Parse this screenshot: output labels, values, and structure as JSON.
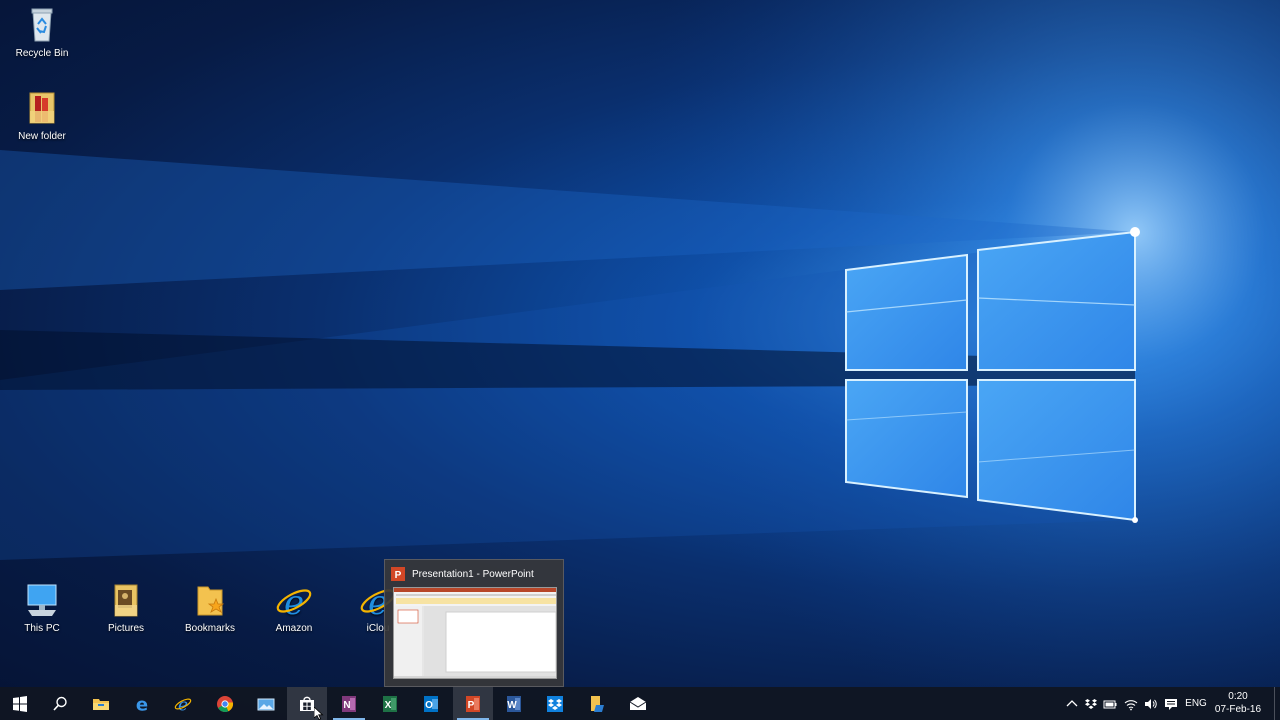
{
  "desktop": {
    "icons_top": [
      {
        "label": "Recycle Bin",
        "icon": "recycle-bin-icon"
      },
      {
        "label": "New folder",
        "icon": "folder-books-icon"
      }
    ],
    "icons_bottom": [
      {
        "label": "This PC",
        "icon": "computer-icon"
      },
      {
        "label": "Pictures",
        "icon": "pictures-folder-icon"
      },
      {
        "label": "Bookmarks",
        "icon": "bookmarks-folder-icon"
      },
      {
        "label": "Amazon",
        "icon": "internet-explorer-icon"
      },
      {
        "label": "iClou",
        "icon": "internet-explorer-icon"
      }
    ]
  },
  "thumbnail": {
    "title": "Presentation1 - PowerPoint",
    "icon": "powerpoint-icon"
  },
  "taskbar": {
    "start": "windows-logo-icon",
    "search": "search-icon",
    "apps": [
      {
        "name": "file-explorer",
        "icon": "folder-icon",
        "running": false
      },
      {
        "name": "edge",
        "icon": "edge-icon",
        "running": false
      },
      {
        "name": "internet-explorer",
        "icon": "internet-explorer-icon",
        "running": false
      },
      {
        "name": "chrome",
        "icon": "chrome-icon",
        "running": false
      },
      {
        "name": "photos",
        "icon": "photos-icon",
        "running": false
      },
      {
        "name": "store",
        "icon": "store-icon",
        "running": false,
        "hovered": true
      },
      {
        "name": "onenote",
        "icon": "onenote-icon",
        "running": true
      },
      {
        "name": "excel",
        "icon": "excel-icon",
        "running": false
      },
      {
        "name": "outlook",
        "icon": "outlook-icon",
        "running": false
      },
      {
        "name": "powerpoint",
        "icon": "powerpoint-icon",
        "running": true
      },
      {
        "name": "word",
        "icon": "word-icon",
        "running": false
      },
      {
        "name": "dropbox",
        "icon": "dropbox-icon",
        "running": false
      },
      {
        "name": "folder-app",
        "icon": "folder-app-icon",
        "running": false
      },
      {
        "name": "mail",
        "icon": "mail-icon",
        "running": false
      }
    ],
    "tray": {
      "icons": [
        "chevron-up-icon",
        "dropbox-tray-icon",
        "battery-icon",
        "wifi-icon",
        "volume-icon",
        "action-center-icon"
      ],
      "language": "ENG",
      "time": "0:20",
      "date": "07-Feb-16"
    }
  },
  "colors": {
    "accent": "#1e7ae0",
    "taskbar": "#10161f",
    "powerpoint": "#d24726",
    "excel": "#1e7145",
    "word": "#2b579a",
    "onenote": "#80397b",
    "outlook": "#0072c6"
  }
}
